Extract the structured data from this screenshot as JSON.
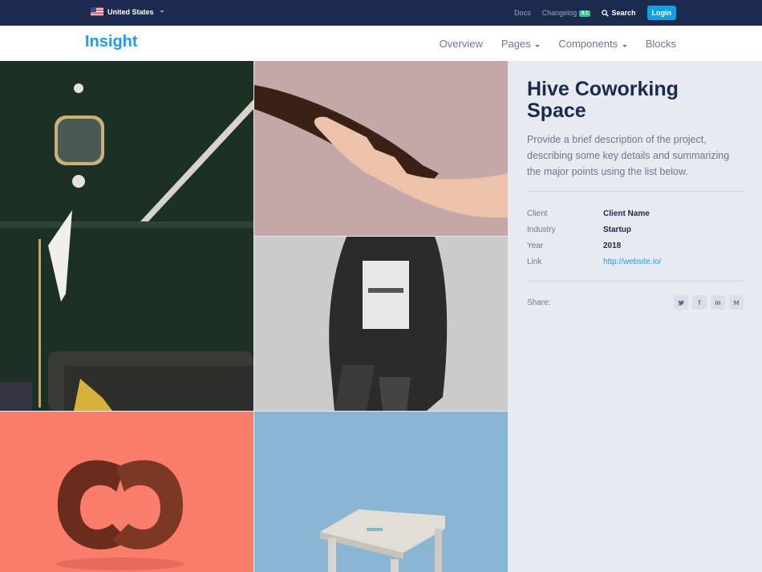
{
  "topbar": {
    "country": "United States",
    "docs": "Docs",
    "changelog": "Changelog",
    "changelog_badge": "0.1",
    "search": "Search",
    "login": "Login"
  },
  "nav": {
    "brand": "Insight",
    "items": [
      "Overview",
      "Pages",
      "Components",
      "Blocks"
    ]
  },
  "project": {
    "title": "Hive Coworking Space",
    "description": "Provide a brief description of the project, describing some key details and summarizing the major points using the list below.",
    "meta": [
      {
        "key": "Client",
        "value": "Client Name"
      },
      {
        "key": "Industry",
        "value": "Startup"
      },
      {
        "key": "Year",
        "value": "2018"
      },
      {
        "key": "Link",
        "value": "http://website.io/"
      }
    ],
    "share_label": "Share:",
    "share_icons": [
      "twitter-icon",
      "facebook-icon",
      "linkedin-icon",
      "medium-icon"
    ]
  },
  "colors": {
    "topbar": "#1b2a4e",
    "brand": "#1f9bed",
    "login": "#0ea2e6",
    "sidebar": "#e7eaf0"
  }
}
